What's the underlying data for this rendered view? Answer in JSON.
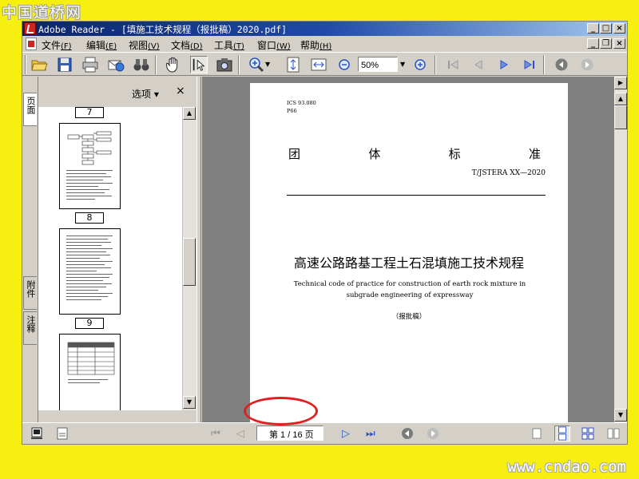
{
  "watermarks": {
    "top": "中国道桥网",
    "bottom": "www.cndao.com"
  },
  "titlebar": {
    "title": "Adobe Reader - [填施工技术规程（报批稿）2020.pdf]"
  },
  "menubar": {
    "items": [
      {
        "label": "文件",
        "key": "(F)"
      },
      {
        "label": "编辑",
        "key": "(E)"
      },
      {
        "label": "视图",
        "key": "(V)"
      },
      {
        "label": "文档",
        "key": "(D)"
      },
      {
        "label": "工具",
        "key": "(T)"
      },
      {
        "label": "窗口",
        "key": "(W)"
      },
      {
        "label": "帮助",
        "key": "(H)"
      }
    ]
  },
  "toolbar": {
    "zoom_value": "50%"
  },
  "left_panel": {
    "tabs": [
      "页面",
      "附件",
      "注释"
    ],
    "options_label": "选项 ▾",
    "close_label": "×",
    "thumbnails": [
      "7",
      "8",
      "9"
    ]
  },
  "document": {
    "ics": "ICS 93.080",
    "p_code": "P66",
    "standard_chars": [
      "团",
      "体",
      "标",
      "准"
    ],
    "code": "T/JSTERA  XX—2020",
    "title_cn": "高速公路路基工程土石混填施工技术规程",
    "title_en": "Technical code of practice for construction of earth rock mixture in subgrade engineering of expressway",
    "draft": "（报批稿）"
  },
  "statusbar": {
    "page_indicator": "第 1 / 16 页"
  }
}
